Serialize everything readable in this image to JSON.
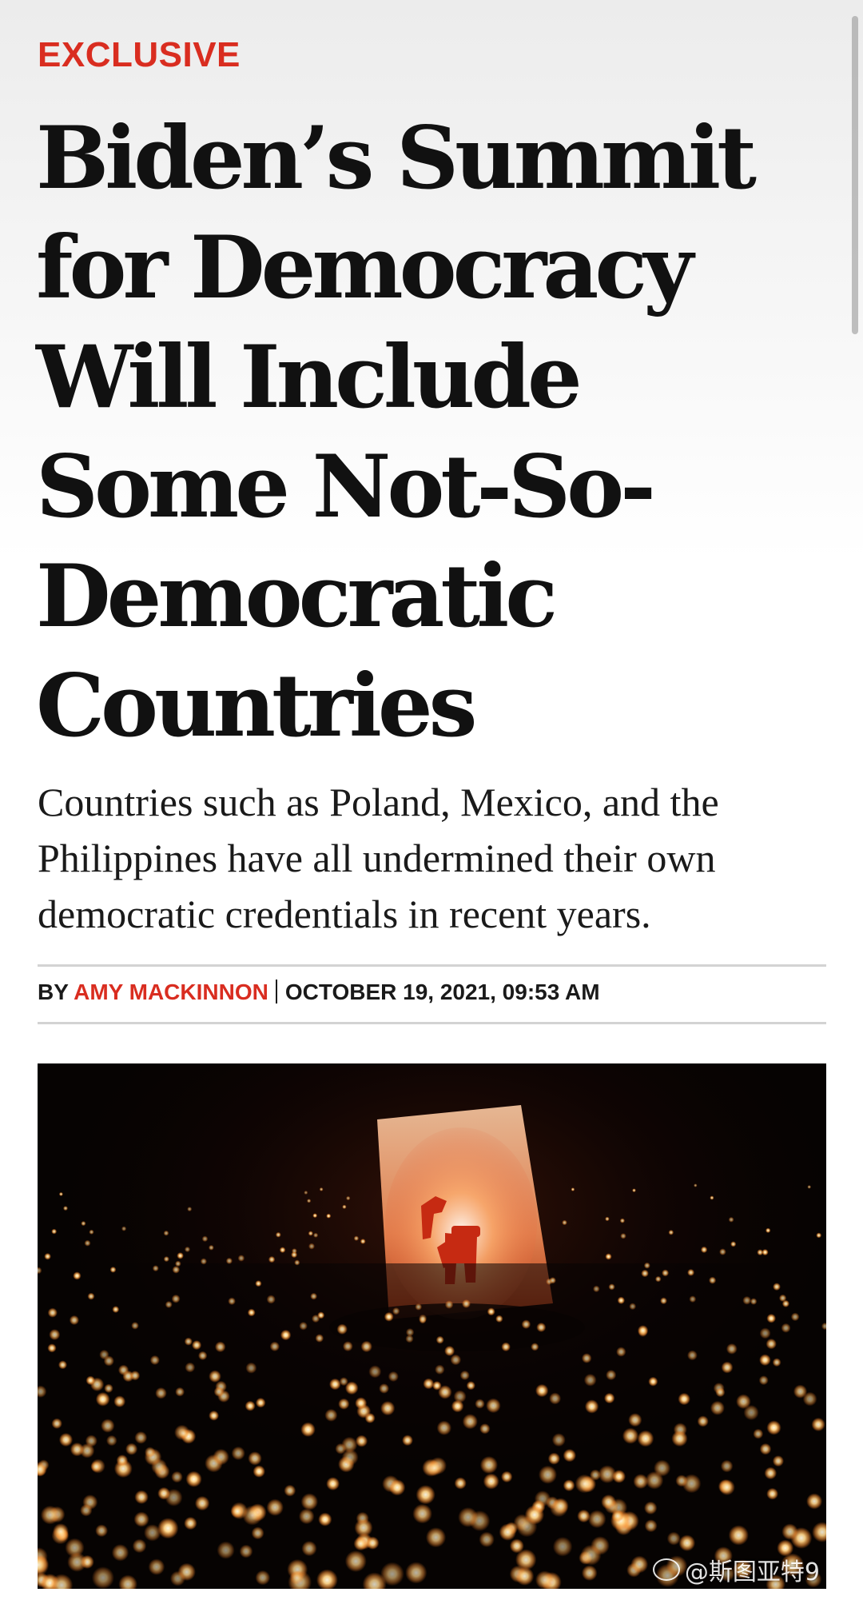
{
  "article": {
    "kicker": "EXCLUSIVE",
    "headline": "Biden’s Summit for Democracy Will Include Some Not-So-Democratic Countries",
    "dek": "Countries such as Poland, Mexico, and the Philippines have all undermined their own democratic credentials in recent years.",
    "byline": {
      "prefix": "BY",
      "author": "AMY MACKINNON",
      "date": "OCTOBER 19, 2021, 09:53 AM"
    }
  },
  "watermark": {
    "text": "@斯图亚特9",
    "icon": "weibo-icon"
  },
  "colors": {
    "accent": "#d92d20",
    "text": "#111111",
    "rule": "#d3d3d3"
  }
}
